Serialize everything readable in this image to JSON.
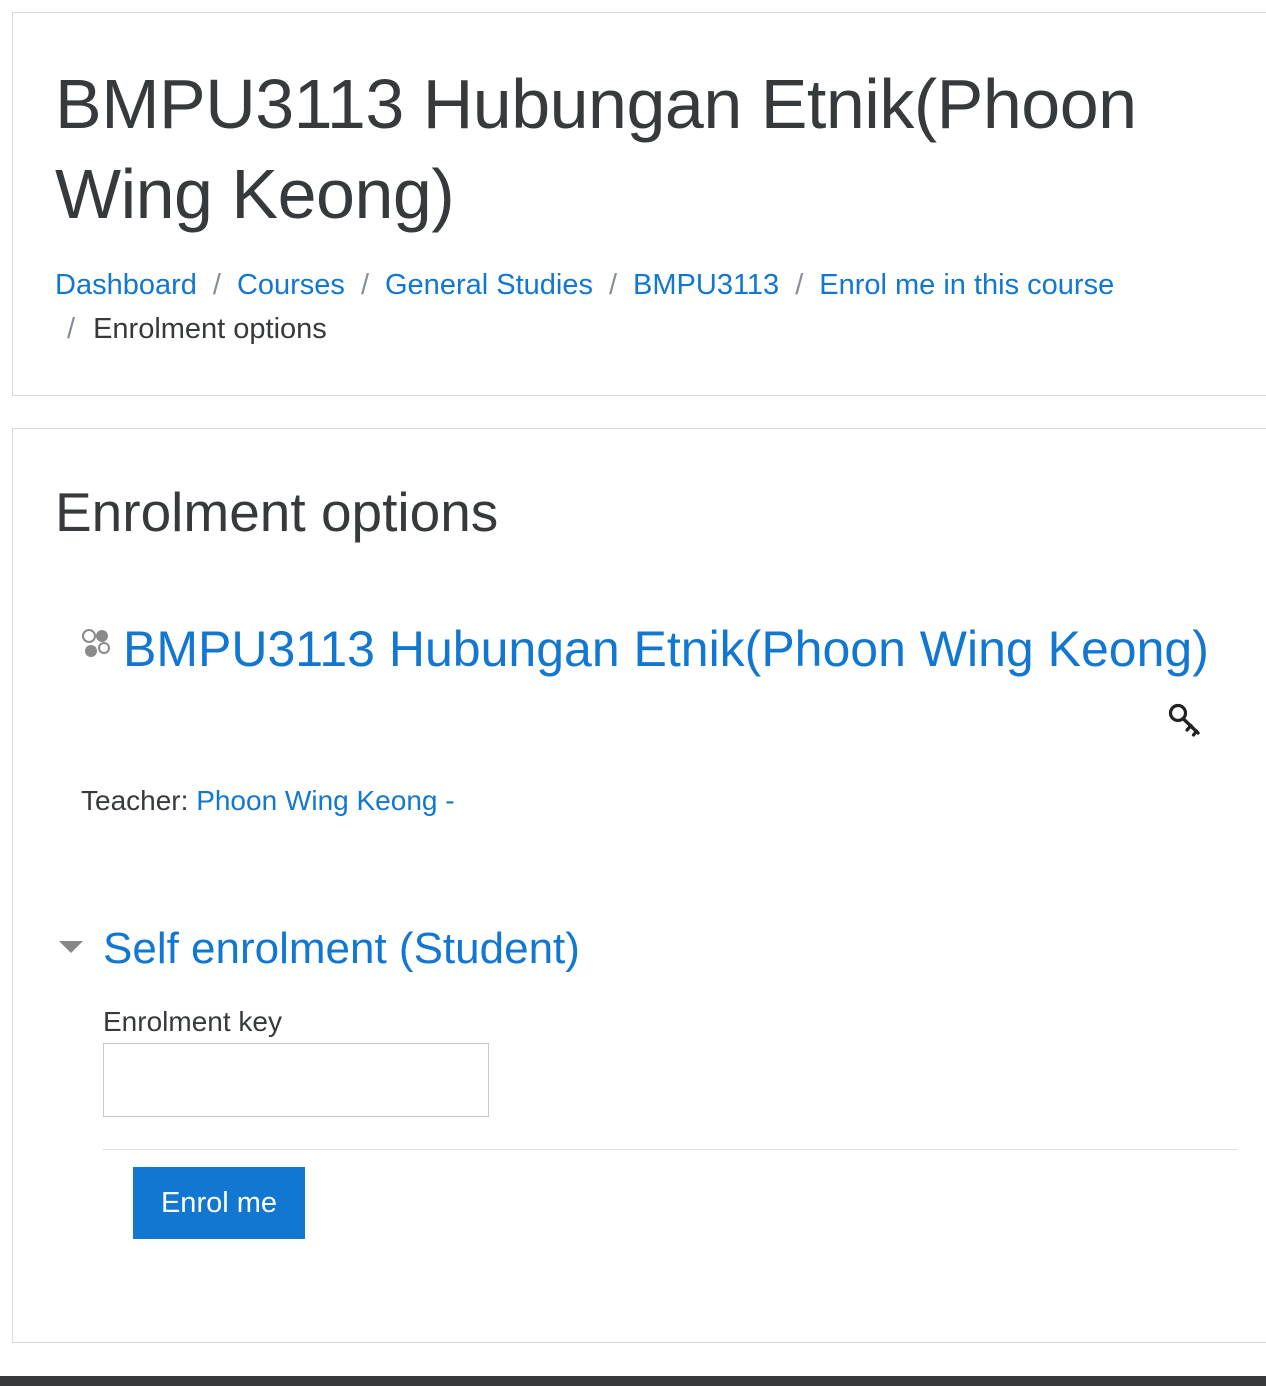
{
  "header": {
    "title": "BMPU3113 Hubungan Etnik(Phoon Wing Keong)",
    "breadcrumb": [
      {
        "label": "Dashboard"
      },
      {
        "label": "Courses"
      },
      {
        "label": "General Studies"
      },
      {
        "label": "BMPU3113"
      },
      {
        "label": "Enrol me in this course"
      },
      {
        "label": "Enrolment options"
      }
    ],
    "breadcrumb_separator": "/"
  },
  "main": {
    "title": "Enrolment options",
    "course": {
      "name": "BMPU3113 Hubungan Etnik(Phoon Wing Keong)",
      "icon": "course-icon",
      "enrol_icon": "key-icon"
    },
    "teacher": {
      "label": "Teacher:",
      "name": "Phoon Wing Keong -"
    },
    "self_enrolment": {
      "title": "Self enrolment (Student)",
      "key_label": "Enrolment key",
      "key_value": "",
      "button_label": "Enrol me"
    }
  },
  "colors": {
    "link": "#1177d1",
    "button": "#1177d1",
    "text": "#373a3c",
    "border": "#d9d9d9",
    "footer": "#373a3c"
  }
}
